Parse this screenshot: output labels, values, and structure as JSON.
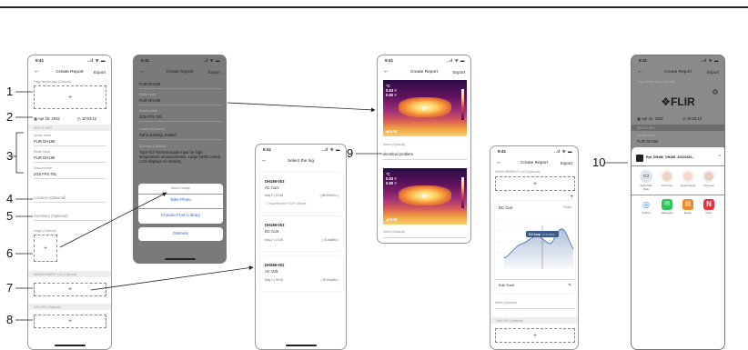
{
  "status": {
    "time": "9:41",
    "signal": "..ıl ᯤ ▬"
  },
  "report": {
    "title": "Create Report",
    "export": "Export",
    "page_header_label": "Page header logo (Optional)",
    "date": "Apr 16, 2022",
    "time": "10:03:12",
    "device_section": "DEVICE INFO",
    "device_name_label": "Device name",
    "device_name": "FLIR DH186",
    "model_name_label": "Model name",
    "model_name": "FLIR DH186",
    "serial_label": "Serial number",
    "serial": "2G5 FFS 781",
    "location": "Location (Optional)",
    "summary": "Summary (Optional)",
    "image_label": "Image (Optional)",
    "measurement_section": "MEASUREMENT LOG (Optional)",
    "gallery_section": "GALLERY (Optional)"
  },
  "phone2": {
    "device_val": "FLIR DH186",
    "location_label": "Location (Optional)",
    "location_val": "Raha solvang, Ireland",
    "summary_label": "Summary (Optional)",
    "summary_val": "Type K/J Thermocouple input for high temperature measurements, Large (4000 count) LCD displays Air Velocity",
    "sheet_title": "Attach image",
    "take_photo": "Take Photo",
    "choose_library": "Choose From Library",
    "dismiss": "Dismiss"
  },
  "phone3": {
    "title": "Select the log",
    "logs": [
      {
        "id": "DH186-003",
        "type": "AC Curr.",
        "date": "May 9 | 14:58",
        "value": "( 88.00m12c )",
        "note": "Imported from FLIR CIEtose"
      },
      {
        "id": "DH186-003",
        "type": "DC Curr.",
        "date": "May 2 | 13:35",
        "value": "( 41mA8hs )",
        "note": ""
      },
      {
        "id": "DH286-001",
        "type": "AC Volt.",
        "date": "May 1 | 09:08",
        "value": "( 2h10m46s )",
        "note": ""
      }
    ]
  },
  "phone4": {
    "temp_top": "°C\n0.83 ×\n0.80 ×",
    "notes_label": "Notes (Optional)",
    "notes_val": "electrical problem",
    "notes_label2": "Notes (Optional)",
    "flir": "◆FLIR"
  },
  "phone5": {
    "section": "MEASUREMENT LOG (Optional)",
    "chart_title": "DC Curr.",
    "chart_sub": "Reset",
    "tooltip": "5.0 Amp",
    "tooltip_time": "10:14 05:38",
    "edit_chart": "Edit Chart",
    "notes": "Notes (Optional)",
    "gallery": "GALLERY (Optional)"
  },
  "phone6": {
    "logo": "❖FLIR",
    "date": "Apr 16, 2022",
    "time": "10:03:12",
    "section": "DEVICE INFO",
    "device_label": "Device name",
    "device": "FLIR DH186",
    "filename": "Rpt_DH186_DH186_20220420...",
    "close": "×",
    "contacts": [
      {
        "name": "Apple Mac\nData",
        "color": "#dfe6ee"
      },
      {
        "name": "First Last",
        "color": "#f0d2c0"
      },
      {
        "name": "Group Name",
        "color": "#f6d7c8"
      },
      {
        "name": "First Last",
        "color": "#e8cfc0"
      }
    ],
    "apps": [
      {
        "name": "Airdrop",
        "color": "#2a7ee8",
        "glyph": "◎"
      },
      {
        "name": "Messages",
        "color": "#2fc45a",
        "glyph": "✉"
      },
      {
        "name": "Books",
        "color": "#f08a20",
        "glyph": "▤"
      },
      {
        "name": "News",
        "color": "#e8303e",
        "glyph": "N"
      }
    ]
  },
  "callouts": [
    "1",
    "2",
    "3",
    "4",
    "5",
    "6",
    "7",
    "8",
    "9",
    "10"
  ]
}
